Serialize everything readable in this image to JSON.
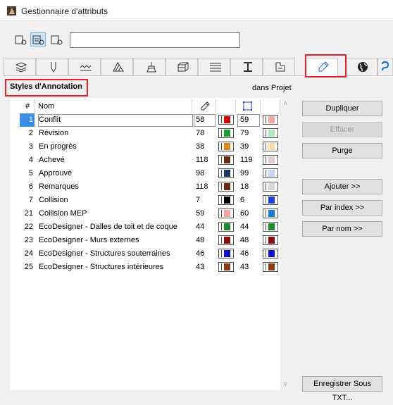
{
  "window": {
    "title": "Gestionnaire d'attributs"
  },
  "toolbar": {
    "view_buttons": [
      "view-list-icon",
      "view-detail-icon",
      "view-preview-icon"
    ],
    "search": {
      "value": "",
      "placeholder": ""
    }
  },
  "tabs": [
    {
      "icon": "layers-icon"
    },
    {
      "icon": "pen-icon"
    },
    {
      "icon": "line-types-icon"
    },
    {
      "icon": "fill-icon"
    },
    {
      "icon": "surface-brush-icon"
    },
    {
      "icon": "building-material-icon"
    },
    {
      "icon": "composite-icon"
    },
    {
      "icon": "profile-icon"
    },
    {
      "icon": "zone-category-icon"
    },
    {
      "icon": "annotation-style-icon",
      "active": true
    },
    {
      "icon": "globe-icon"
    },
    {
      "icon": "mep-icon"
    }
  ],
  "panel": {
    "title": "Styles d'Annotation",
    "scope": "dans Projet",
    "columns": {
      "index": "#",
      "name": "Nom"
    },
    "rows": [
      {
        "index": "1",
        "name": "Conflit",
        "v1": "58",
        "v2": "59",
        "c1": "#d40000",
        "c2": "#f4a6a6",
        "selected": true
      },
      {
        "index": "2",
        "name": "Révision",
        "v1": "78",
        "v2": "79",
        "c1": "#1a9e3a",
        "c2": "#b4e8c0"
      },
      {
        "index": "3",
        "name": "En progrès",
        "v1": "38",
        "v2": "39",
        "c1": "#e08a1a",
        "c2": "#f8dcb4"
      },
      {
        "index": "4",
        "name": "Achevé",
        "v1": "118",
        "v2": "119",
        "c1": "#6a2a14",
        "c2": "#e0cfc8"
      },
      {
        "index": "5",
        "name": "Approuvé",
        "v1": "98",
        "v2": "99",
        "c1": "#1a3a6a",
        "c2": "#c4d4ec"
      },
      {
        "index": "6",
        "name": "Remarques",
        "v1": "118",
        "v2": "18",
        "c1": "#6a2a14",
        "c2": "#d8d8d8"
      },
      {
        "index": "7",
        "name": "Collision",
        "v1": "7",
        "v2": "6",
        "c1": "#000000",
        "c2": "#1f3ed8"
      },
      {
        "index": "21",
        "name": "Collision MEP",
        "v1": "59",
        "v2": "60",
        "c1": "#f4a6a6",
        "c2": "#1a7ad8"
      },
      {
        "index": "22",
        "name": "EcoDesigner - Dalles de toit et de coque",
        "v1": "44",
        "v2": "44",
        "c1": "#1a8a2a",
        "c2": "#1a8a2a"
      },
      {
        "index": "23",
        "name": "EcoDesigner - Murs externes",
        "v1": "48",
        "v2": "48",
        "c1": "#8a1010",
        "c2": "#8a1010"
      },
      {
        "index": "24",
        "name": "EcoDesigner - Structures souterraines",
        "v1": "46",
        "v2": "46",
        "c1": "#1010c8",
        "c2": "#1010c8"
      },
      {
        "index": "25",
        "name": "EcoDesigner - Structures intérieures",
        "v1": "43",
        "v2": "43",
        "c1": "#8a3a10",
        "c2": "#8a3a10"
      }
    ]
  },
  "actions": {
    "duplicate": "Dupliquer",
    "delete": "Effacer",
    "purge": "Purge",
    "append": "Ajouter >>",
    "by_index": "Par index >>",
    "by_name": "Par nom >>",
    "save_txt": "Enregistrer Sous TXT..."
  },
  "colors": {
    "accent": "#3a8ee6",
    "highlight": "#e8202a"
  }
}
